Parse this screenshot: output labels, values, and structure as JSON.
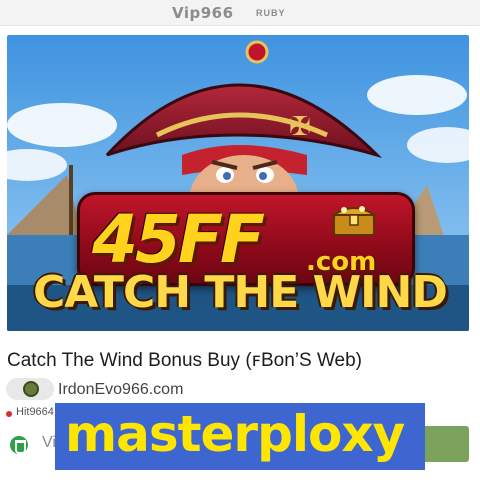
{
  "header": {
    "site_title": "Vip966",
    "site_sub": "RUBY"
  },
  "hero": {
    "logo_main": "45FF",
    "logo_domain": ".com",
    "game_logo_text": "CATCH THE WIND",
    "icons": [
      "pirate-character",
      "treasure-chest-icon"
    ]
  },
  "game": {
    "title": "Catch The Wind Bonus Buy (ꜰBon’S Web)",
    "provider_name": "IrdonEvo966.com",
    "meta_text": "Hit9664 coon",
    "vip_label": "Vip",
    "play_label": "ON"
  },
  "banner": {
    "text": "masterploxy"
  },
  "colors": {
    "banner_bg": "#3e66d0",
    "banner_text": "#ffe600",
    "logo_red": "#c0152a",
    "logo_gold": "#ffd21e",
    "play_button": "#7ba35c",
    "status_dot": "#d62c2c"
  }
}
